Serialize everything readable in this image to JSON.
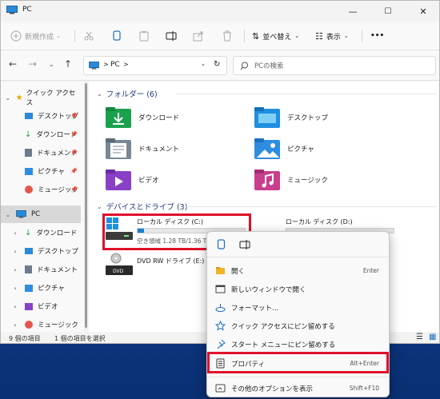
{
  "window": {
    "title": "PC"
  },
  "titlebar": {
    "minimize": "—",
    "maximize": "☐",
    "close": "✕"
  },
  "toolbar": {
    "new_label": "新規作成",
    "sort_label": "並べ替え",
    "view_label": "表示",
    "more_label": "•••"
  },
  "address": {
    "path_sep": ">",
    "path_item": "PC",
    "path_sep2": ">",
    "search_placeholder": "PCの検索"
  },
  "sidebar": {
    "items": [
      {
        "label": "クイック アクセス",
        "kind": "group"
      },
      {
        "label": "デスクトップ",
        "kind": "pinned"
      },
      {
        "label": "ダウンロード",
        "kind": "pinned"
      },
      {
        "label": "ドキュメント",
        "kind": "pinned"
      },
      {
        "label": "ピクチャ",
        "kind": "pinned"
      },
      {
        "label": "ミュージック",
        "kind": "pinned"
      },
      {
        "label": "PC",
        "kind": "group-selected"
      },
      {
        "label": "ダウンロード",
        "kind": "child"
      },
      {
        "label": "デスクトップ",
        "kind": "child"
      },
      {
        "label": "ドキュメント",
        "kind": "child"
      },
      {
        "label": "ピクチャ",
        "kind": "child"
      },
      {
        "label": "ビデオ",
        "kind": "child"
      },
      {
        "label": "ミュージック",
        "kind": "child"
      }
    ]
  },
  "content": {
    "folders_header": "フォルダー (6)",
    "folders": [
      {
        "label": "ダウンロード"
      },
      {
        "label": "デスクトップ"
      },
      {
        "label": "ドキュメント"
      },
      {
        "label": "ピクチャ"
      },
      {
        "label": "ビデオ"
      },
      {
        "label": "ミュージック"
      }
    ],
    "drives_header": "デバイスとドライブ (3)",
    "drives": [
      {
        "label": "ローカル ディスク (C:)",
        "space": "空き領域 1.28 TB/1.36 T",
        "used_fraction": 0.06
      },
      {
        "label": "ローカル ディスク (D:)",
        "space": "",
        "used_fraction": 0.0
      },
      {
        "label": "DVD RW ドライブ (E:)",
        "space": ""
      }
    ]
  },
  "status": {
    "count": "9 個の項目",
    "selected": "1 個の項目を選択"
  },
  "context_menu": {
    "items": [
      {
        "label": "開く",
        "shortcut": "Enter"
      },
      {
        "label": "新しいウィンドウで開く",
        "shortcut": ""
      },
      {
        "label": "フォーマット...",
        "shortcut": ""
      },
      {
        "label": "クイック アクセスにピン留めする",
        "shortcut": ""
      },
      {
        "label": "スタート メニューにピン留めする",
        "shortcut": ""
      },
      {
        "label": "プロパティ",
        "shortcut": "Alt+Enter"
      },
      {
        "label": "その他のオプションを表示",
        "shortcut": "Shift+F10"
      }
    ]
  },
  "colors": {
    "accent": "#0067c0",
    "highlight": "#e0102b",
    "selected_bg": "#d8d8d8"
  }
}
